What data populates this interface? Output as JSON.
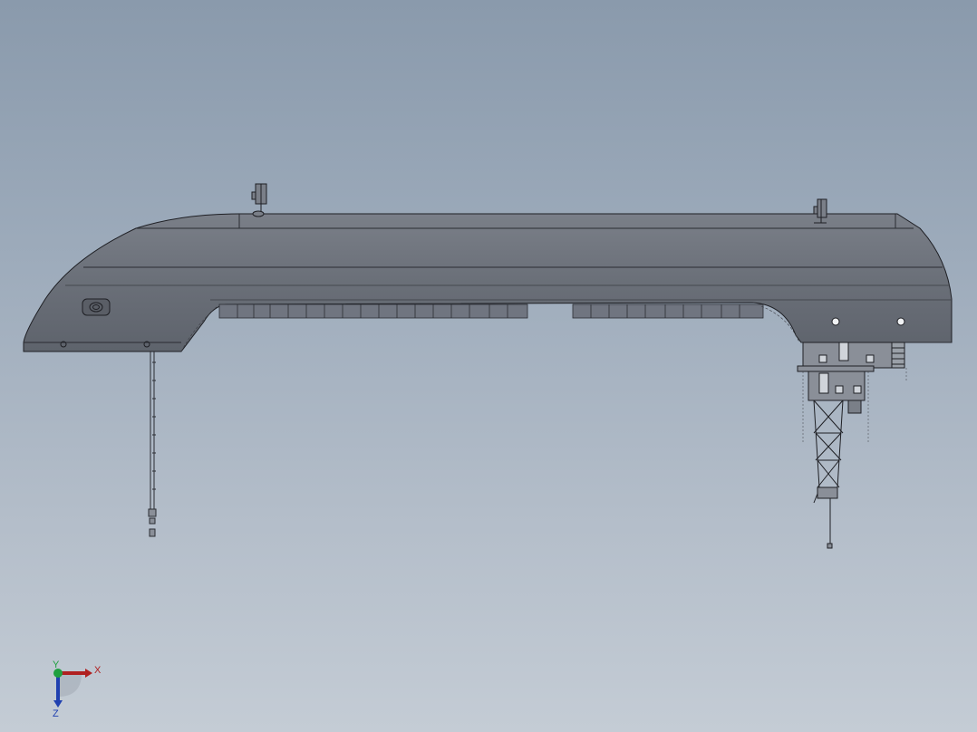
{
  "viewport": {
    "background_top": "#8a9aac",
    "background_bottom": "#c4ccd5",
    "model_color": "#6a6f78",
    "edge_color": "#1e1f24"
  },
  "triad": {
    "x_label": "X",
    "y_label": "Y",
    "z_label": "Z",
    "x_color": "#b02020",
    "y_color": "#20a040",
    "z_color": "#2040b0"
  }
}
